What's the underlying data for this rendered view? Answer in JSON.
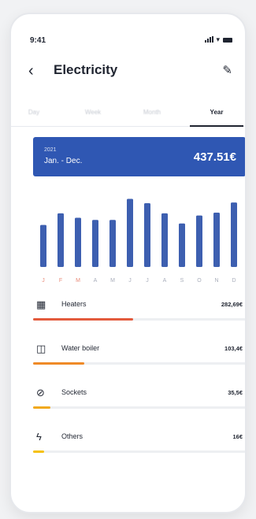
{
  "status": {
    "time": "9:41"
  },
  "header": {
    "title": "Electricity",
    "back_icon": "chevron-left-icon",
    "edit_icon": "pencil-icon"
  },
  "tabs": [
    {
      "label": "Day",
      "active": false
    },
    {
      "label": "Week",
      "active": false
    },
    {
      "label": "Month",
      "active": false
    },
    {
      "label": "Year",
      "active": true
    }
  ],
  "period": {
    "year": "2021",
    "range": "Jan. - Dec.",
    "total": "437.51€",
    "color": "#2f57b3"
  },
  "chart_data": {
    "type": "bar",
    "categories": [
      "J",
      "F",
      "M",
      "A",
      "M",
      "J",
      "J",
      "A",
      "S",
      "O",
      "N",
      "D"
    ],
    "values": [
      58,
      74,
      68,
      65,
      65,
      94,
      88,
      74,
      60,
      71,
      75,
      89
    ],
    "ylim": [
      0,
      100
    ],
    "bar_color": "#3d5fb0",
    "category_label_color": "#e98b79"
  },
  "categories": [
    {
      "name": "Heaters",
      "amount": "282,69€",
      "icon": "heater-icon",
      "share": 0.47,
      "color": "#e35a3c"
    },
    {
      "name": "Water boiler",
      "amount": "103,4€",
      "icon": "water-boiler-icon",
      "share": 0.24,
      "color": "#ef8a27"
    },
    {
      "name": "Sockets",
      "amount": "35,5€",
      "icon": "plug-icon",
      "share": 0.08,
      "color": "#f1a91c"
    },
    {
      "name": "Others",
      "amount": "16€",
      "icon": "lightning-icon",
      "share": 0.05,
      "color": "#f5c10e"
    }
  ]
}
